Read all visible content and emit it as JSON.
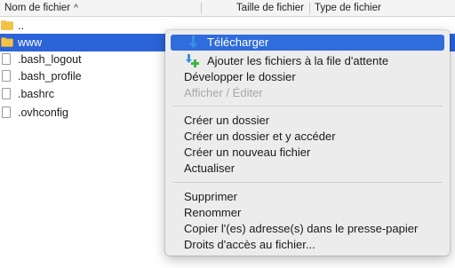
{
  "columns": {
    "name": "Nom de fichier",
    "size": "Taille de fichier",
    "type": "Type de fichier"
  },
  "files": [
    {
      "name": "..",
      "icon": "folder-icon"
    },
    {
      "name": "www",
      "icon": "folder-icon",
      "selected": true
    },
    {
      "name": ".bash_logout",
      "icon": "document-icon"
    },
    {
      "name": ".bash_profile",
      "icon": "document-icon"
    },
    {
      "name": ".bashrc",
      "icon": "document-icon"
    },
    {
      "name": ".ovhconfig",
      "icon": "document-icon"
    }
  ],
  "context_menu": {
    "group1": [
      {
        "label": "Télécharger",
        "icon": "download-icon",
        "highlighted": true
      },
      {
        "label": "Ajouter les fichiers à la file d'attente",
        "icon": "add-to-queue-icon"
      },
      {
        "label": "Développer le dossier"
      },
      {
        "label": "Afficher / Éditer",
        "disabled": true
      }
    ],
    "group2": [
      {
        "label": "Créer un dossier"
      },
      {
        "label": "Créer un dossier et y accéder"
      },
      {
        "label": "Créer un nouveau fichier"
      },
      {
        "label": "Actualiser"
      }
    ],
    "group3": [
      {
        "label": "Supprimer"
      },
      {
        "label": "Renommer"
      },
      {
        "label": "Copier l'(es) adresse(s) dans le presse-papier"
      },
      {
        "label": "Droits d'accès au fichier..."
      }
    ]
  },
  "colors": {
    "selection": "#2b63d9",
    "menu_highlight": "#2f6cdc",
    "folder": "#f5c242",
    "download_arrow": "#3a8fe0",
    "queue_plus": "#3cb44b"
  }
}
